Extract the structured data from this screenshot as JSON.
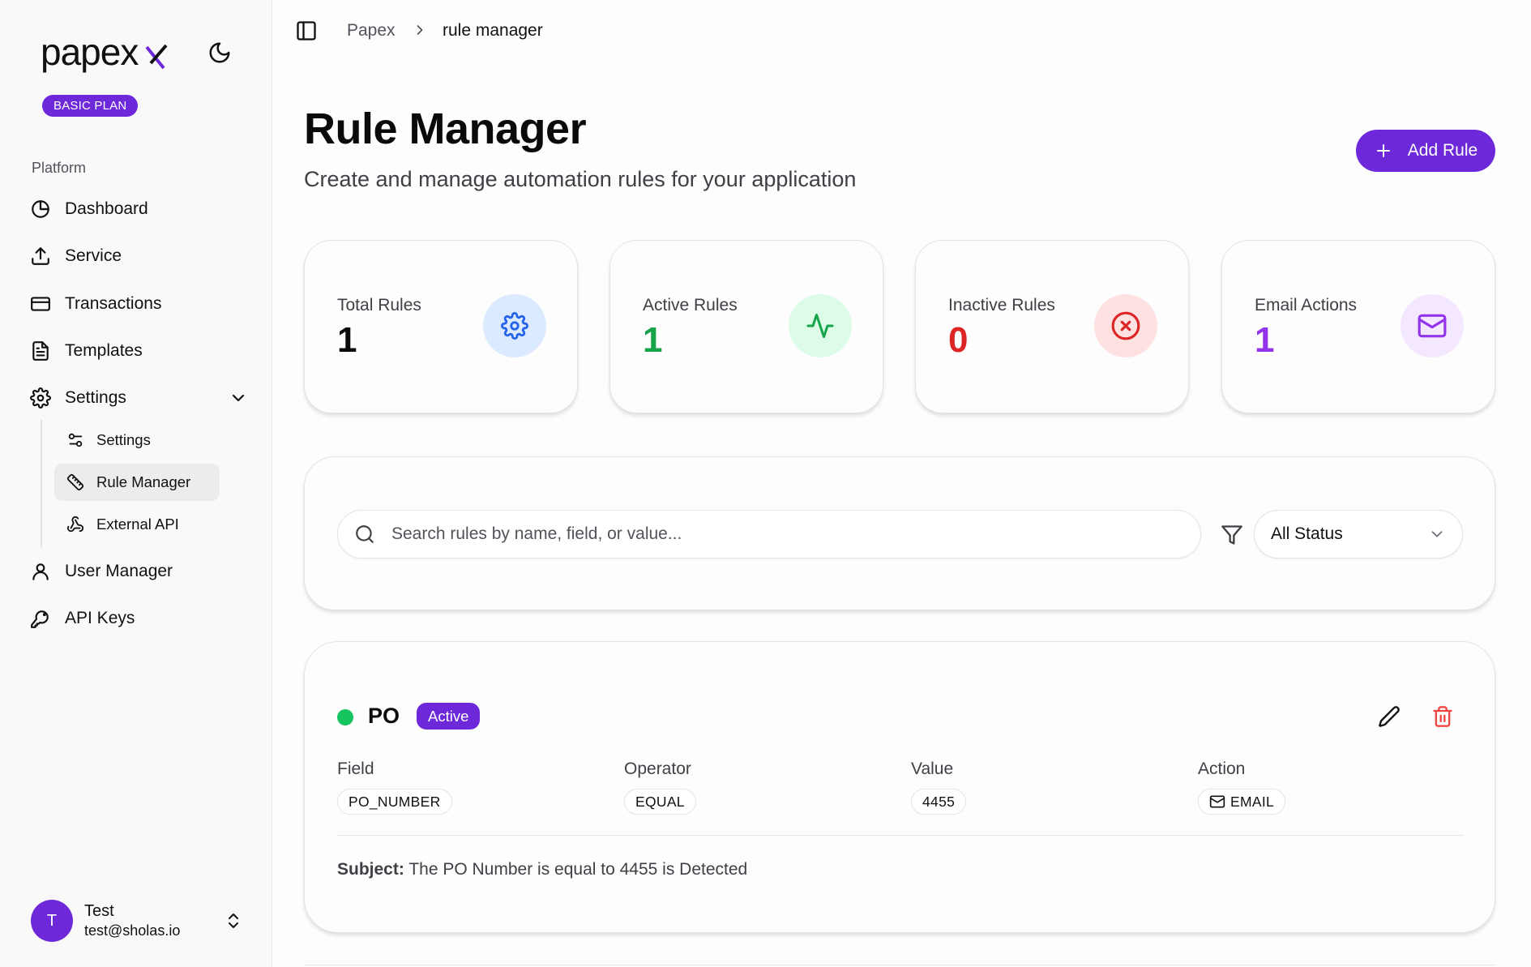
{
  "sidebar": {
    "logo_text": "papex",
    "plan_badge": "BASIC PLAN",
    "section_label": "Platform",
    "items": [
      {
        "label": "Dashboard",
        "icon": "pie-chart-icon"
      },
      {
        "label": "Service",
        "icon": "upload-icon"
      },
      {
        "label": "Transactions",
        "icon": "credit-card-icon"
      },
      {
        "label": "Templates",
        "icon": "file-text-icon"
      },
      {
        "label": "Settings",
        "icon": "gear-icon"
      },
      {
        "label": "User Manager",
        "icon": "user-icon"
      },
      {
        "label": "API Keys",
        "icon": "key-icon"
      }
    ],
    "sub_items": [
      {
        "label": "Settings",
        "icon": "sliders-icon"
      },
      {
        "label": "Rule Manager",
        "icon": "ruler-icon",
        "active": true
      },
      {
        "label": "External API",
        "icon": "webhook-icon"
      }
    ],
    "user": {
      "initial": "T",
      "name": "Test",
      "email": "test@sholas.io"
    }
  },
  "header": {
    "breadcrumb": [
      "Papex",
      "rule manager"
    ]
  },
  "page": {
    "title": "Rule Manager",
    "subtitle": "Create and manage automation rules for your application",
    "add_button": "Add Rule"
  },
  "stats": [
    {
      "label": "Total Rules",
      "value": "1",
      "color": "#0a0a0a",
      "icon": "gear-icon",
      "icon_color": "#2563eb",
      "bubble": "#dbeafe"
    },
    {
      "label": "Active Rules",
      "value": "1",
      "color": "#16a34a",
      "icon": "activity-icon",
      "icon_color": "#16a34a",
      "bubble": "#dcfce7"
    },
    {
      "label": "Inactive Rules",
      "value": "0",
      "color": "#dc2626",
      "icon": "x-circle-icon",
      "icon_color": "#dc2626",
      "bubble": "#fee2e2"
    },
    {
      "label": "Email Actions",
      "value": "1",
      "color": "#9333ea",
      "icon": "mail-icon",
      "icon_color": "#9333ea",
      "bubble": "#f3e8ff"
    }
  ],
  "filters": {
    "search_placeholder": "Search rules by name, field, or value...",
    "status_value": "All Status"
  },
  "rules": [
    {
      "name": "PO",
      "status": "Active",
      "field_label": "Field",
      "field": "PO_NUMBER",
      "operator_label": "Operator",
      "operator": "EQUAL",
      "value_label": "Value",
      "value": "4455",
      "action_label": "Action",
      "action": "EMAIL",
      "subject_label": "Subject:",
      "subject": "The PO Number is equal to 4455 is Detected"
    }
  ],
  "colors": {
    "accent": "#6d28d9",
    "active_dot": "#16c55e",
    "danger": "#dc2626"
  }
}
